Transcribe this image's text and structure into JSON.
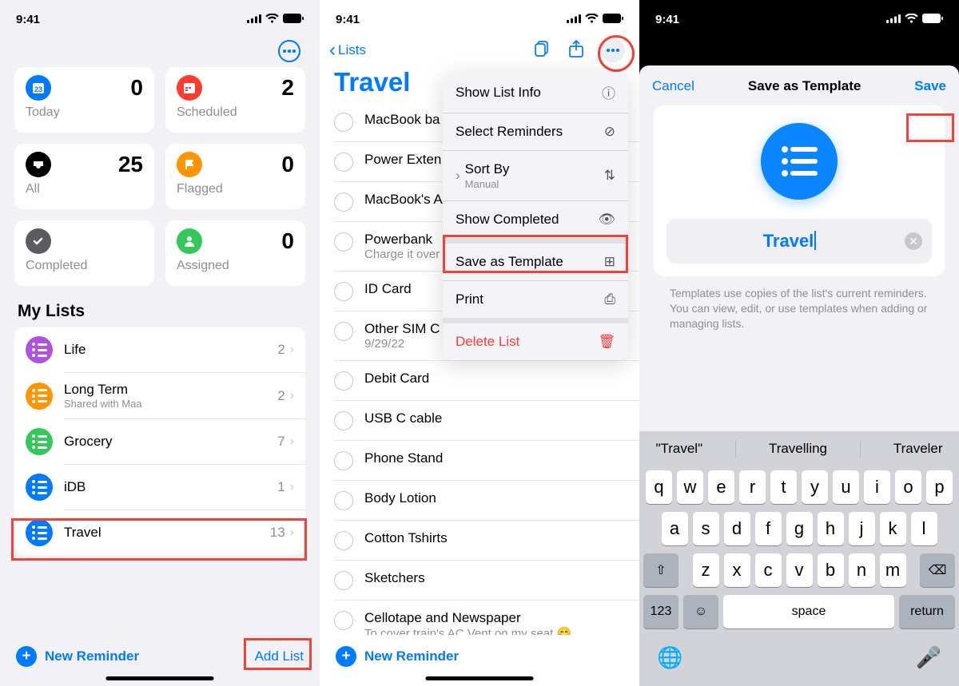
{
  "status": {
    "time": "9:41"
  },
  "panel1": {
    "tiles": [
      {
        "label": "Today",
        "count": "0",
        "color": "#007aff",
        "icon": "calendar"
      },
      {
        "label": "Scheduled",
        "count": "2",
        "color": "#ff3b30",
        "icon": "calendar"
      },
      {
        "label": "All",
        "count": "25",
        "color": "#000",
        "icon": "tray"
      },
      {
        "label": "Flagged",
        "count": "0",
        "color": "#ff9500",
        "icon": "flag"
      },
      {
        "label": "Completed",
        "count": "",
        "color": "#8e8e93",
        "icon": "check"
      },
      {
        "label": "Assigned",
        "count": "0",
        "color": "#34c759",
        "icon": "person"
      }
    ],
    "section": "My Lists",
    "lists": [
      {
        "name": "Life",
        "sub": "",
        "count": "2",
        "color": "#af52de"
      },
      {
        "name": "Long Term",
        "sub": "Shared with Maa",
        "count": "2",
        "color": "#ff9500"
      },
      {
        "name": "Grocery",
        "sub": "",
        "count": "7",
        "color": "#34c759"
      },
      {
        "name": "iDB",
        "sub": "",
        "count": "1",
        "color": "#007aff"
      },
      {
        "name": "Travel",
        "sub": "",
        "count": "13",
        "color": "#007aff"
      }
    ],
    "new_reminder": "New Reminder",
    "add_list": "Add List"
  },
  "panel2": {
    "back": "Lists",
    "title": "Travel",
    "reminders": [
      {
        "title": "MacBook ba",
        "sub": ""
      },
      {
        "title": "Power Exten",
        "sub": ""
      },
      {
        "title": "MacBook's A",
        "sub": ""
      },
      {
        "title": "Powerbank",
        "sub": "Charge it over"
      },
      {
        "title": "ID Card",
        "sub": ""
      },
      {
        "title": "Other SIM C",
        "sub": "9/29/22"
      },
      {
        "title": "Debit Card",
        "sub": ""
      },
      {
        "title": "USB C cable",
        "sub": ""
      },
      {
        "title": "Phone Stand",
        "sub": ""
      },
      {
        "title": "Body Lotion",
        "sub": ""
      },
      {
        "title": "Cotton Tshirts",
        "sub": ""
      },
      {
        "title": "Sketchers",
        "sub": ""
      },
      {
        "title": "Cellotape and Newspaper",
        "sub": "To cover train's AC Vent on my seat 😄"
      }
    ],
    "new_reminder": "New Reminder",
    "menu": {
      "show_info": "Show List Info",
      "select": "Select Reminders",
      "sort_by": "Sort By",
      "sort_mode": "Manual",
      "show_completed": "Show Completed",
      "save_template": "Save as Template",
      "print": "Print",
      "delete": "Delete List"
    }
  },
  "panel3": {
    "cancel": "Cancel",
    "title": "Save as Template",
    "save": "Save",
    "template_name": "Travel",
    "help": "Templates use copies of the list's current reminders. You can view, edit, or use templates when adding or managing lists.",
    "suggestions": [
      "\"Travel\"",
      "Travelling",
      "Traveler"
    ],
    "keys_r1": [
      "q",
      "w",
      "e",
      "r",
      "t",
      "y",
      "u",
      "i",
      "o",
      "p"
    ],
    "keys_r2": [
      "a",
      "s",
      "d",
      "f",
      "g",
      "h",
      "j",
      "k",
      "l"
    ],
    "keys_r3": [
      "z",
      "x",
      "c",
      "v",
      "b",
      "n",
      "m"
    ],
    "numkey": "123",
    "space": "space",
    "return": "return"
  }
}
